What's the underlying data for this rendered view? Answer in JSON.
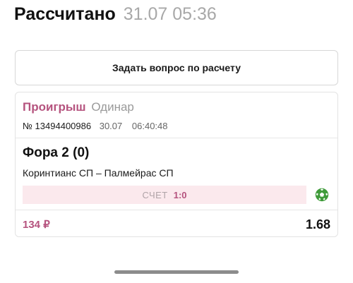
{
  "header": {
    "title": "Рассчитано",
    "datetime": "31.07 05:36"
  },
  "ask_button": {
    "label": "Задать вопрос по расчету"
  },
  "bet": {
    "status": "Проигрыш",
    "type": "Одинар",
    "number": "№ 13494400986",
    "date": "30.07",
    "time": "06:40:48",
    "market": "Фора 2 (0)",
    "event": "Коринтианс СП – Палмейрас СП",
    "score_label": "СЧЕТ",
    "score_value": "1:0",
    "sport_icon": "soccer-ball-icon",
    "stake": "134 ₽",
    "odds": "1.68"
  },
  "colors": {
    "accent": "#b5537e",
    "score_bg": "#fbe9ed",
    "sport_icon": "#3f9b3a"
  }
}
